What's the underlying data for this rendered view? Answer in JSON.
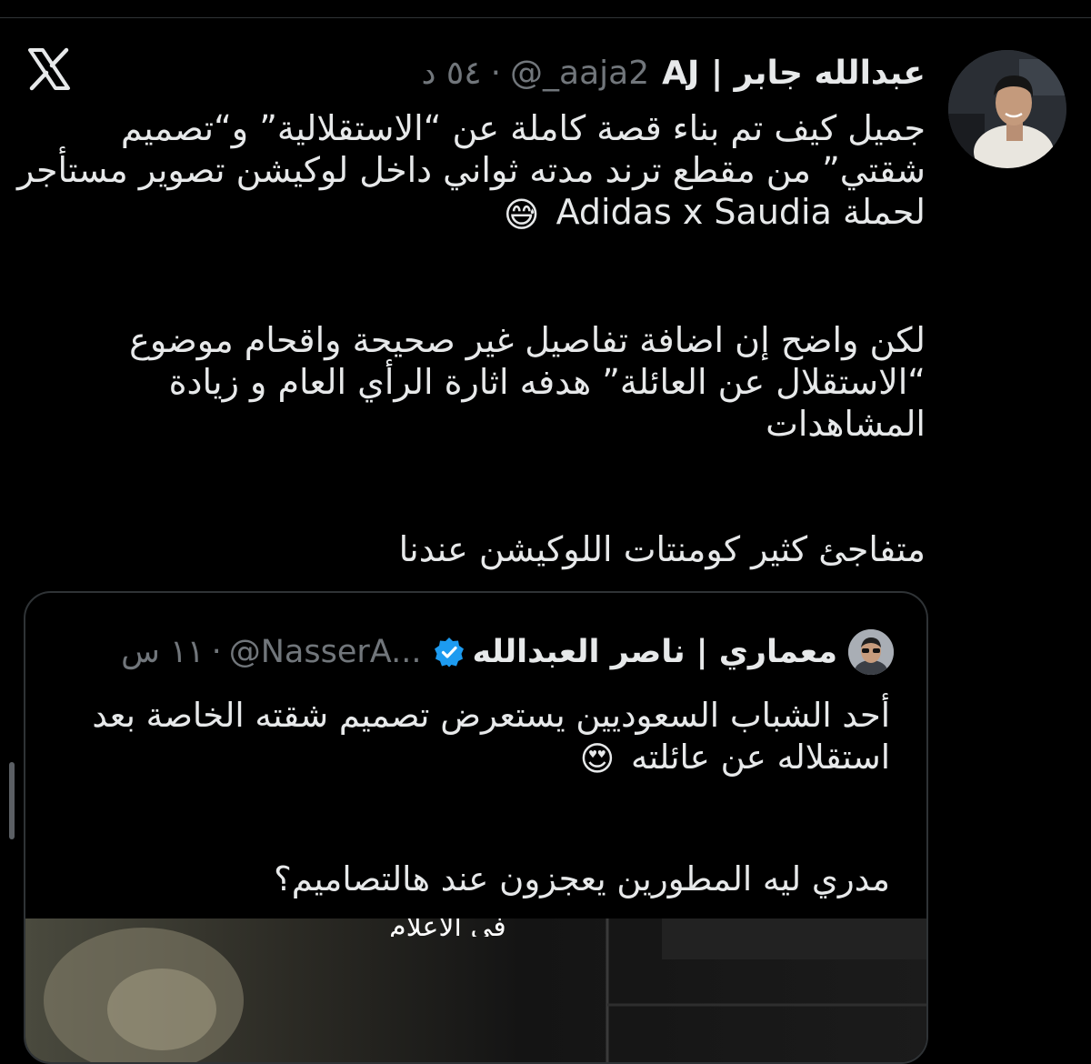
{
  "tweet": {
    "author": {
      "display_name": "عبدالله جابر | AJ",
      "handle": "@_aaja2",
      "time": "٥٤ د"
    },
    "meta_separator": "·",
    "paragraphs": [
      "جميل كيف تم بناء قصة كاملة عن “الاستقلالية” و“تصميم شقتي” من مقطع ترند مدته ثواني داخل لوكيشن تصوير مستأجر لحملة Adidas x Saudia",
      "لكن واضح إن اضافة تفاصيل غير صحيحة واقحام موضوع “الاستقلال عن العائلة” هدفه اثارة الرأي العام و زيادة المشاهدات",
      "متفاجئ كثير كومنتات اللوكيشن عندنا"
    ],
    "emoji_1": "😅"
  },
  "quote": {
    "display_name": "معماري | ناصر العبدالله",
    "handle": "@NasserA...",
    "time": "١١ س",
    "meta_separator": "·",
    "paragraphs": [
      "أحد الشباب السعوديين يستعرض تصميم شقته الخاصة بعد استقلاله عن عائلته",
      "مدري ليه المطورين يعجزون عند هالتصاميم؟"
    ],
    "emoji_1": "😍",
    "media_caption": "في الأعلام"
  },
  "icons": {
    "brand": "x-logo-icon",
    "verified": "verified-badge-icon"
  },
  "colors": {
    "background": "#000000",
    "text": "#e7e9ea",
    "secondary_text": "#71767b",
    "border": "#2f3336",
    "verified": "#1d9bf0"
  }
}
